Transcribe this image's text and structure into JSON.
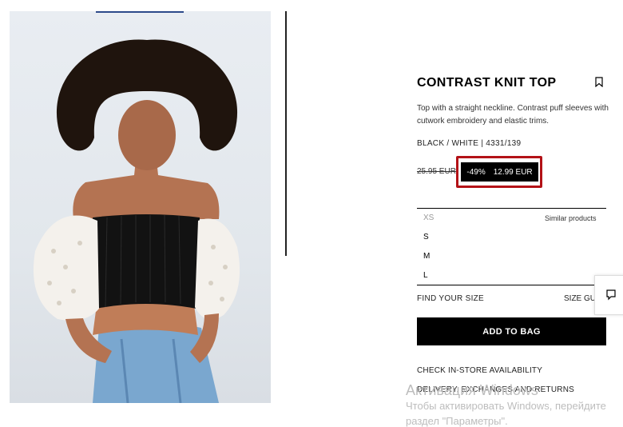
{
  "product": {
    "title": "CONTRAST KNIT TOP",
    "description": "Top with a straight neckline. Contrast puff sleeves with cutwork embroidery and elastic trims.",
    "color_ref": "BLACK / WHITE | 4331/139",
    "old_price": "25.95 EUR",
    "discount": "-49%",
    "price": "12.99 EUR"
  },
  "sizes": {
    "options": [
      "XS",
      "S",
      "M",
      "L"
    ],
    "similar_products": "Similar products"
  },
  "size_help": {
    "find_your_size": "FIND YOUR SIZE",
    "size_guide": "SIZE GU"
  },
  "add_to_bag": "ADD TO BAG",
  "links": {
    "check_store": "CHECK IN-STORE AVAILABILITY",
    "delivery": "DELIVERY, EXCHANGES AND RETURNS"
  },
  "watermark": {
    "line1": "Активация Windows",
    "line2": "Чтобы активировать Windows, перейдите",
    "line3": "раздел \"Параметры\"."
  },
  "colors": {
    "highlight": "#b31217",
    "price_bg": "#000000",
    "button_bg": "#000000"
  }
}
